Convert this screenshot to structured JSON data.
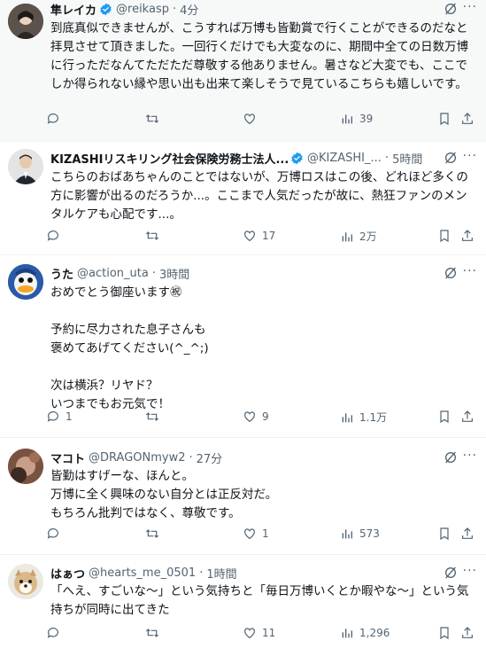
{
  "posts": [
    {
      "name": "隼レイカ",
      "verified": true,
      "handle": "@reikasp",
      "time": "4分",
      "text": "到底真似できませんが、こうすれば万博も皆勤賞で行くことができるのだなと拝見させて頂きました。一回行くだけでも大変なのに、期間中全ての日数万博に行っただなんてただただ尊敬する他ありません。暑さなど大変でも、ここでしか得られない縁や思い出も出来て楽しそうで見ているこちらも嬉しいです。",
      "replies": "",
      "reposts": "",
      "likes": "",
      "views": "39"
    },
    {
      "name": "KIZASHIリスキリング社会保険労務士法人...",
      "verified": true,
      "handle": "@KIZASHI_...",
      "time": "5時間",
      "text": "こちらのおばあちゃんのことではないが、万博ロスはこの後、どれほど多くの方に影響が出るのだろうか...。ここまで人気だったが故に、熱狂ファンのメンタルケアも心配です...。",
      "replies": "",
      "reposts": "",
      "likes": "17",
      "views": "2万"
    },
    {
      "name": "うた",
      "verified": false,
      "handle": "@action_uta",
      "time": "3時間",
      "text": "おめでとう御座います㊗\n\n予約に尽力された息子さんも\n褒めてあげてください(^_^;)\n\n次は横浜？リヤド？\nいつまでもお元気で！",
      "replies": "1",
      "reposts": "",
      "likes": "9",
      "views": "1.1万"
    },
    {
      "name": "マコト",
      "verified": false,
      "handle": "@DRAGONmyw2",
      "time": "27分",
      "text": "皆勤はすげーな、ほんと。\n万博に全く興味のない自分とは正反対だ。\nもちろん批判ではなく、尊敬です。",
      "replies": "",
      "reposts": "",
      "likes": "1",
      "views": "573"
    },
    {
      "name": "はぁつ",
      "verified": false,
      "handle": "@hearts_me_0501",
      "time": "1時間",
      "text": "「へえ、すごいな〜」という気持ちと「毎日万博いくとか暇やな〜」という気持ちが同時に出てきた",
      "replies": "",
      "reposts": "",
      "likes": "11",
      "views": "1,296"
    }
  ],
  "separator": "·",
  "more_glyph": "···",
  "colors": {
    "verified": "#1d9bf0",
    "muted": "#536471",
    "text": "#0f1419",
    "highlight_bg": "#f7f9f9"
  },
  "icons": [
    "reply-icon",
    "repost-icon",
    "like-icon",
    "views-icon",
    "bookmark-icon",
    "share-icon",
    "grok-icon",
    "verified-badge-icon",
    "more-icon"
  ]
}
